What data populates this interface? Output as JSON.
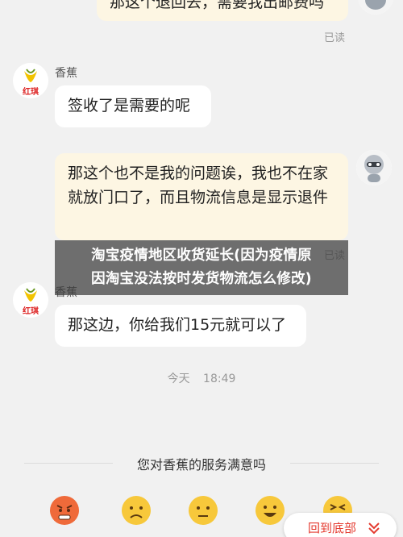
{
  "messages": {
    "m1_text": "那这个退回去，需要我出邮费吗",
    "m1_read": "已读",
    "m2_name": "香蕉",
    "m2_text": "签收了是需要的呢",
    "m3_text": "那这个也不是我的问题诶，我也不在家就放门口了，而且物流信息是显示退件",
    "m3_read": "已读",
    "m4_name": "香蕉",
    "m4_text": "那这边，你给我们15元就可以了"
  },
  "avatar": {
    "seller_logo_text": "红琪"
  },
  "timestamp": {
    "day": "今天",
    "time": "18:49"
  },
  "overlay": {
    "line1": "淘宝疫情地区收货延长(因为疫情原",
    "line2": "因淘宝没法按时发货物流怎么修改)"
  },
  "survey": {
    "title": "您对香蕉的服务满意吗",
    "options": [
      "very-unsatisfied",
      "unsatisfied",
      "neutral",
      "satisfied",
      "very-satisfied"
    ]
  },
  "bottom_button": {
    "label": "回到底部"
  },
  "colors": {
    "background": "#f1f1f1",
    "buyer_bubble": "#fdf6e3",
    "seller_bubble": "#ffffff",
    "accent": "#e43a2f"
  }
}
